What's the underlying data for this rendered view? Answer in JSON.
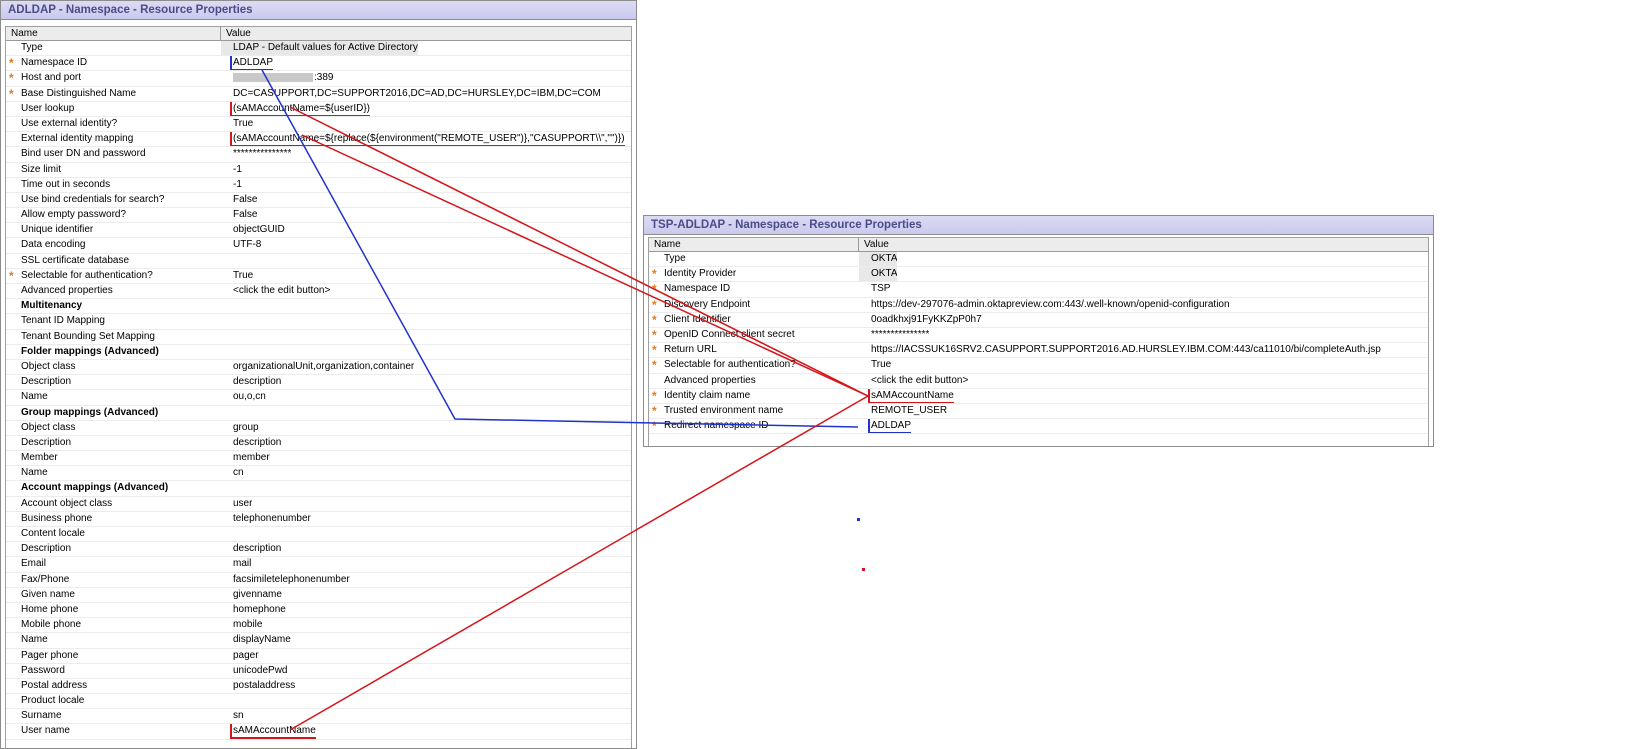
{
  "left_panel": {
    "title": "ADLDAP - Namespace - Resource Properties",
    "col_name": "Name",
    "col_value": "Value",
    "rows": [
      {
        "name": "Type",
        "value": "LDAP - Default values for Active Directory",
        "req": false,
        "shaded": true
      },
      {
        "name": "Namespace ID",
        "value": "ADLDAP",
        "req": true,
        "box": "blue"
      },
      {
        "name": "Host and port",
        "value": ":389",
        "req": true,
        "blurred": true
      },
      {
        "name": "Base Distinguished Name",
        "value": "DC=CASUPPORT,DC=SUPPORT2016,DC=AD,DC=HURSLEY,DC=IBM,DC=COM",
        "req": true
      },
      {
        "name": "User lookup",
        "value": "(sAMAccountName=${userID})",
        "req": false,
        "edit": true,
        "box": "red"
      },
      {
        "name": "Use external identity?",
        "value": "True",
        "req": false,
        "edit": true
      },
      {
        "name": "External identity mapping",
        "value": "(sAMAccountName=${replace(${environment(\"REMOTE_USER\")},\"CASUPPORT\\\\\",\"\")})",
        "req": false,
        "edit": true,
        "box": "red"
      },
      {
        "name": "Bind user DN and password",
        "value": "***************",
        "req": false
      },
      {
        "name": "Size limit",
        "value": "-1",
        "req": false
      },
      {
        "name": "Time out in seconds",
        "value": "-1",
        "req": false
      },
      {
        "name": "Use bind credentials for search?",
        "value": "False",
        "req": false
      },
      {
        "name": "Allow empty password?",
        "value": "False",
        "req": false
      },
      {
        "name": "Unique identifier",
        "value": "objectGUID",
        "req": false
      },
      {
        "name": "Data encoding",
        "value": "UTF-8",
        "req": false
      },
      {
        "name": "SSL certificate database",
        "value": "",
        "req": false
      },
      {
        "name": "Selectable for authentication?",
        "value": "True",
        "req": true
      },
      {
        "name": "Advanced properties",
        "value": "<click the edit button>",
        "req": false
      },
      {
        "name": "Multitenancy",
        "value": "",
        "section": true
      },
      {
        "name": "Tenant ID Mapping",
        "value": "",
        "req": false
      },
      {
        "name": "Tenant Bounding Set Mapping",
        "value": "",
        "req": false
      },
      {
        "name": "Folder mappings (Advanced)",
        "value": "",
        "section": true
      },
      {
        "name": "Object class",
        "value": "organizationalUnit,organization,container",
        "req": false
      },
      {
        "name": "Description",
        "value": "description",
        "req": false
      },
      {
        "name": "Name",
        "value": "ou,o,cn",
        "req": false
      },
      {
        "name": "Group mappings (Advanced)",
        "value": "",
        "section": true
      },
      {
        "name": "Object class",
        "value": "group",
        "req": false
      },
      {
        "name": "Description",
        "value": "description",
        "req": false
      },
      {
        "name": "Member",
        "value": "member",
        "req": false
      },
      {
        "name": "Name",
        "value": "cn",
        "req": false
      },
      {
        "name": "Account mappings (Advanced)",
        "value": "",
        "section": true
      },
      {
        "name": "Account object class",
        "value": "user",
        "req": false
      },
      {
        "name": "Business phone",
        "value": "telephonenumber",
        "req": false
      },
      {
        "name": "Content locale",
        "value": "",
        "req": false
      },
      {
        "name": "Description",
        "value": "description",
        "req": false
      },
      {
        "name": "Email",
        "value": "mail",
        "req": false
      },
      {
        "name": "Fax/Phone",
        "value": "facsimiletelephonenumber",
        "req": false
      },
      {
        "name": "Given name",
        "value": "givenname",
        "req": false
      },
      {
        "name": "Home phone",
        "value": "homephone",
        "req": false
      },
      {
        "name": "Mobile phone",
        "value": "mobile",
        "req": false
      },
      {
        "name": "Name",
        "value": "displayName",
        "req": false
      },
      {
        "name": "Pager phone",
        "value": "pager",
        "req": false
      },
      {
        "name": "Password",
        "value": "unicodePwd",
        "req": false
      },
      {
        "name": "Postal address",
        "value": "postaladdress",
        "req": false
      },
      {
        "name": "Product locale",
        "value": "",
        "req": false
      },
      {
        "name": "Surname",
        "value": "sn",
        "req": false
      },
      {
        "name": "User name",
        "value": "sAMAccountName",
        "req": false,
        "box": "red"
      }
    ]
  },
  "right_panel": {
    "title": "TSP-ADLDAP - Namespace - Resource Properties",
    "col_name": "Name",
    "col_value": "Value",
    "rows": [
      {
        "name": "Type",
        "value": "OKTA",
        "req": false,
        "shaded": true
      },
      {
        "name": "Identity Provider",
        "value": "OKTA",
        "req": true,
        "shaded": true
      },
      {
        "name": "Namespace ID",
        "value": "TSP",
        "req": true
      },
      {
        "name": "Discovery Endpoint",
        "value": "https://dev-297076-admin.oktapreview.com:443/.well-known/openid-configuration",
        "req": true
      },
      {
        "name": "Client Identifier",
        "value": "0oadkhxj91FyKKZpP0h7",
        "req": true
      },
      {
        "name": "OpenID Connect client secret",
        "value": "***************",
        "req": true
      },
      {
        "name": "Return URL",
        "value": "https://IACSSUK16SRV2.CASUPPORT.SUPPORT2016.AD.HURSLEY.IBM.COM:443/ca11010/bi/completeAuth.jsp",
        "req": true
      },
      {
        "name": "Selectable for authentication?",
        "value": "True",
        "req": true
      },
      {
        "name": "Advanced properties",
        "value": "<click the edit button>",
        "req": false
      },
      {
        "name": "Identity claim name",
        "value": "sAMAccountName",
        "req": true,
        "box": "red"
      },
      {
        "name": "Trusted environment name",
        "value": "REMOTE_USER",
        "req": true
      },
      {
        "name": "Redirect namespace ID",
        "value": "ADLDAP",
        "req": true,
        "box": "blue"
      }
    ]
  },
  "annotation_colors": {
    "red": "#d4151b",
    "blue": "#2233cc",
    "required": "#e07a1f"
  }
}
